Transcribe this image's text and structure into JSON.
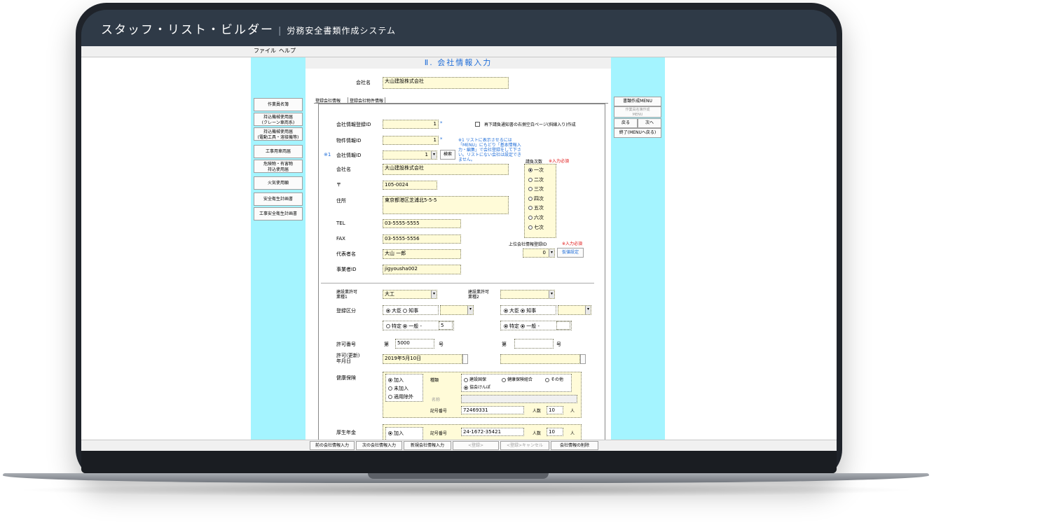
{
  "app": {
    "title": "スタッフ・リスト・ビルダー",
    "separator": "|",
    "subtitle": "労務安全書類作成システム"
  },
  "menu": {
    "file": "ファイル",
    "help": "ヘルプ"
  },
  "form": {
    "title": "Ⅱ. 会社情報入力",
    "company_label": "会社名",
    "company_value": "大山建設株式会社"
  },
  "left_nav": [
    "作業員名簿",
    "持込機械使用届\n(クレーン車両系)",
    "持込機械使用届\n(電動工具・溶接機等)",
    "工事用車両届",
    "危険物・有害物\n持込使用届",
    "火気使用願",
    "安全衛生計画書",
    "工事安全衛生計画書"
  ],
  "right_nav": {
    "menu": "書類作成MENU",
    "sub": "作業員名簿作成\nMENU",
    "back": "戻る",
    "next": "次へ",
    "exit": "終了(MENUへ戻る)"
  },
  "tabs": {
    "t1": "登録会社情報",
    "t2": "登録会社物件情報"
  },
  "fields": {
    "company_id_label": "会社情報登録ID",
    "company_id_value": "1",
    "star": "*",
    "property_id_label": "物件情報ID",
    "property_id_value": "1",
    "note_mark": "※1",
    "company_info_id_label": "会社情報ID",
    "company_info_id_value": "1",
    "search": "検索",
    "reprint_label": "再下請負通知書の右側空白ページ(斜線入り)作成",
    "note_text": "※1 リストに表示させるには「MENU」にもどり「基本情報入力・編集」で会社登録をして下さい。リストにない会社は設定できません。",
    "name_label": "会社名",
    "name_value": "大山建設株式会社",
    "zip_label": "〒",
    "zip_value": "105-0024",
    "address_label": "住所",
    "address_value": "東京都港区芝浦北5-5-5",
    "tel_label": "TEL",
    "tel_value": "03-5555-5555",
    "fax_label": "FAX",
    "fax_value": "03-5555-5556",
    "rep_label": "代表者名",
    "rep_value": "大山 一郎",
    "office_label": "事業者ID",
    "office_value": "jigyousha002"
  },
  "contract": {
    "label": "請負次数",
    "req": "※入力必須",
    "options": [
      "一次",
      "二次",
      "三次",
      "四次",
      "五次",
      "六次",
      "七次"
    ],
    "selected": 0,
    "upper_label": "上位会社情報登録ID",
    "upper_req": "※入力必須",
    "upper_value": "0",
    "upper_btn": "仮値設定"
  },
  "license": {
    "type1_label": "建設業許可\n業種1",
    "type1_value": "大工",
    "type2_label": "建設業許可\n業種2",
    "type2_value": "",
    "reg_label": "登録区分",
    "minister": "大臣",
    "governor": "知事",
    "special": "特定",
    "general": "一般",
    "dash": "-",
    "general_no": "5",
    "permit_label": "許可番号",
    "dai": "第",
    "permit_value": "5000",
    "go": "号",
    "date_label": "許可(更新)\n年月日",
    "date_value": "2019年5月10日"
  },
  "insurance": {
    "health_label": "健康保険",
    "join": "加入",
    "not_join": "未加入",
    "exempt": "適用除外",
    "kind_label": "種類",
    "kind1": "建設国保",
    "kind2": "健康保険組合",
    "kind3": "その他",
    "kind4": "協会けんぽ",
    "name_label": "名称",
    "code_label": "記号番号",
    "code_value": "72469331",
    "people_label": "人数",
    "people_value": "10",
    "people_unit": "人",
    "pension_label": "厚生年金",
    "pension_join": "加入",
    "pension_code": "24-1672-35421",
    "pension_people": "10"
  },
  "bottom": [
    "前の会社情報入力",
    "次の会社情報入力",
    "新規会社情報入力",
    "<登録>",
    "<登録>キャンセル",
    "会社情報の削除"
  ],
  "colors": {
    "accent": "#1d6cd8",
    "panel": "#a4f4ff",
    "field": "#fffbd8",
    "required": "#e01010"
  }
}
